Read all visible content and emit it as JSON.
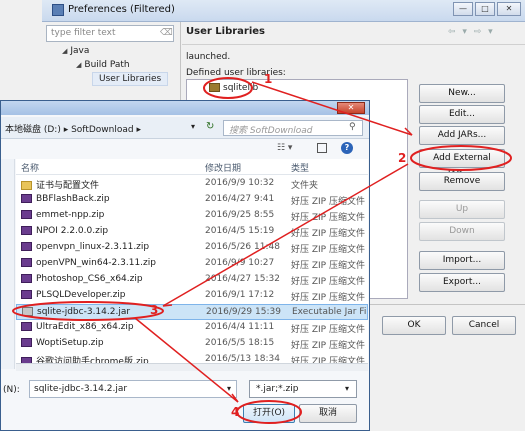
{
  "prefs": {
    "title": "Preferences (Filtered)",
    "filter_placeholder": "type filter text",
    "tree": {
      "java": "Java",
      "build_path": "Build Path",
      "user_libraries": "User Libraries"
    },
    "page_title": "User Libraries",
    "launched_text": "launched.",
    "defined_text": "Defined user libraries:",
    "library": "sqlitelib",
    "buttons": {
      "new": "New...",
      "edit": "Edit...",
      "add_jars": "Add JARs...",
      "add_external_jars": "Add External JARs...",
      "remove": "Remove",
      "up": "Up",
      "down": "Down",
      "import": "Import...",
      "export": "Export...",
      "ok": "OK",
      "cancel": "Cancel"
    }
  },
  "dialog": {
    "breadcrumb": "本地磁盘 (D:) ▸ SoftDownload ▸",
    "search_placeholder": "搜索 SoftDownload",
    "columns": {
      "name": "名称",
      "date": "修改日期",
      "type": "类型"
    },
    "files": [
      {
        "name": "证书与配置文件",
        "date": "2016/9/9 10:32",
        "type": "文件夹",
        "icon": "folder"
      },
      {
        "name": "BBFlashBack.zip",
        "date": "2016/4/27 9:41",
        "type": "好压 ZIP 压缩文件",
        "icon": "zip"
      },
      {
        "name": "emmet-npp.zip",
        "date": "2016/9/25 8:55",
        "type": "好压 ZIP 压缩文件",
        "icon": "zip"
      },
      {
        "name": "NPOI 2.2.0.0.zip",
        "date": "2016/4/5 15:19",
        "type": "好压 ZIP 压缩文件",
        "icon": "zip"
      },
      {
        "name": "openvpn_linux-2.3.11.zip",
        "date": "2016/5/26 11:48",
        "type": "好压 ZIP 压缩文件",
        "icon": "zip"
      },
      {
        "name": "openVPN_win64-2.3.11.zip",
        "date": "2016/9/9 10:27",
        "type": "好压 ZIP 压缩文件",
        "icon": "zip"
      },
      {
        "name": "Photoshop_CS6_x64.zip",
        "date": "2016/4/27 15:32",
        "type": "好压 ZIP 压缩文件",
        "icon": "zip"
      },
      {
        "name": "PLSQLDeveloper.zip",
        "date": "2016/9/1 17:12",
        "type": "好压 ZIP 压缩文件",
        "icon": "zip"
      },
      {
        "name": "sqlite-jdbc-3.14.2.jar",
        "date": "2016/9/29 15:39",
        "type": "Executable Jar File",
        "icon": "jar",
        "selected": true
      },
      {
        "name": "UltraEdit_x86_x64.zip",
        "date": "2016/4/4 11:11",
        "type": "好压 ZIP 压缩文件",
        "icon": "zip"
      },
      {
        "name": "WoptiSetup.zip",
        "date": "2016/5/5 18:15",
        "type": "好压 ZIP 压缩文件",
        "icon": "zip"
      },
      {
        "name": "谷歌访问助手chrome版.zip",
        "date": "2016/5/13 18:34",
        "type": "好压 ZIP 压缩文件",
        "icon": "zip"
      }
    ],
    "filename_label": "(N):",
    "filename_value": "sqlite-jdbc-3.14.2.jar",
    "filter_value": "*.jar;*.zip",
    "open_button": "打开(O)",
    "cancel_button": "取消"
  },
  "annotations": {
    "step1": "1",
    "step2": "2",
    "step3": "3",
    "step4": "4"
  },
  "colors": {
    "annotation": "#e02020",
    "selection": "#cce4f7"
  }
}
